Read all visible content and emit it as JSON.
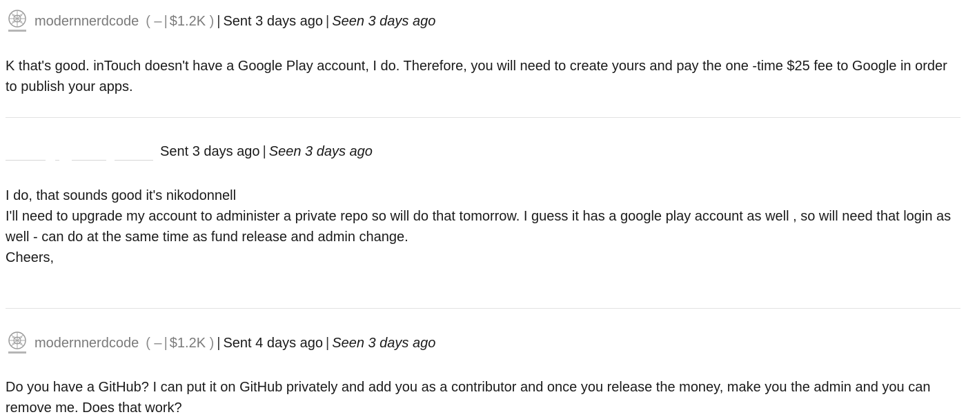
{
  "messages": [
    {
      "username": "modernnerdcode",
      "rep_open": "( –",
      "rep_amount": "$1.2K",
      "rep_close": ")",
      "sent": "Sent 3 days ago",
      "seen": "Seen 3 days ago",
      "lines": [
        "K that's good. inTouch doesn't have a Google Play account, I do. Therefore, you will need to create yours and pay the one -time $25 fee to Google in order",
        "to publish your apps."
      ]
    },
    {
      "username": "",
      "sent": "Sent 3 days ago",
      "seen": "Seen 3 days ago",
      "lines": [
        "I do, that sounds good it's nikodonnell",
        "I'll need to upgrade my account to administer a private repo so will do that tomorrow. I guess it has a google play account as well , so will need that login as",
        "well - can do at the same time as fund release and admin change.",
        "Cheers,"
      ]
    },
    {
      "username": "modernnerdcode",
      "rep_open": "( –",
      "rep_amount": "$1.2K",
      "rep_close": ")",
      "sent": "Sent 4 days ago",
      "seen": "Seen 3 days ago",
      "lines": [
        "Do you have a GitHub? I can put it on GitHub privately and add you as a contributor and once you release the money, make you the admin and you can",
        "remove me. Does that work?"
      ]
    }
  ],
  "separator": "|",
  "avatar_icon": "globe-network-logo-icon"
}
